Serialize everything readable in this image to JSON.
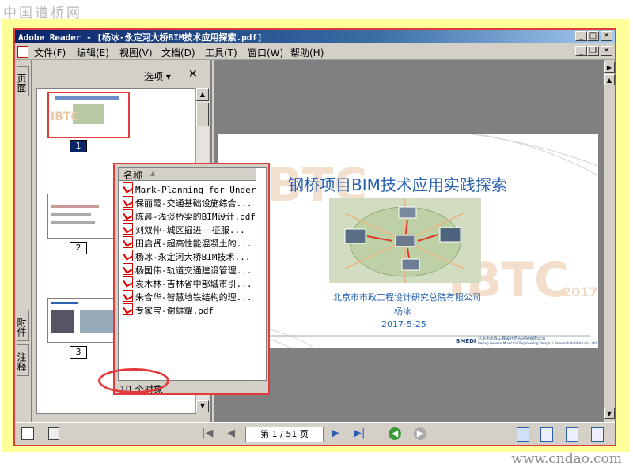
{
  "watermark": {
    "top": "中国道桥网",
    "bottom": "www.cndao.com"
  },
  "window": {
    "title": "Adobe Reader - [杨冰-永定河大桥BIM技术应用探索.pdf]"
  },
  "menu": {
    "items": [
      "文件(F)",
      "编辑(E)",
      "视图(V)",
      "文档(D)",
      "工具(T)",
      "窗口(W)",
      "帮助(H)"
    ]
  },
  "sidebar": {
    "tabs": {
      "pages": "页面",
      "attachments": "附件",
      "comments": "注释"
    },
    "options_label": "选项 ▾",
    "close_glyph": "✕",
    "thumbnails": [
      "1",
      "2",
      "3"
    ]
  },
  "slide": {
    "title": "钢桥项目BIM技术应用实践探索",
    "org": "北京市市政工程设计研究总院有限公司",
    "author": "杨冰",
    "date": "2017-5-25",
    "watermark": "IBTC",
    "watermark_year": "2017",
    "footer_logo": "BMEDI",
    "footer_cn": "北京市市政工程设计研究总院有限公司",
    "footer_en": "Beijing General Municipal Engineering Design & Research Institute Co., Ltd."
  },
  "attachments": {
    "column_header": "名称",
    "files": [
      "Mark-Planning for Under...",
      "保丽霞-交通基础设施综合...",
      "陈晨-浅谈桥梁的BIM设计.pdf",
      "刘双仲-城区掘进——征服...",
      "田启贤-超高性能混凝土的...",
      "杨冰-永定河大桥BIM技术...",
      "杨国伟-轨道交通建设管理...",
      "袁木林-吉林省中部城市引...",
      "朱合华-智慧地铁结构的理...",
      "专家宝-谢雄耀.pdf"
    ],
    "count_label": "10 个对象"
  },
  "statusbar": {
    "page_display": "第 1 / 51 页"
  },
  "colors": {
    "highlight": "#e23b3b",
    "frame": "#ffff99",
    "titlebar": "#0a246a",
    "slide_title": "#2a64b0"
  }
}
